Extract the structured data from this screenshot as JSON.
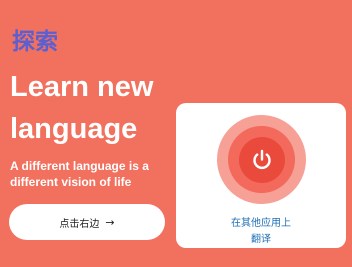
{
  "screen": {
    "title": "探索"
  },
  "hero": {
    "title_line1": "Learn new",
    "title_line2": "language",
    "subtitle": "A different language is a different vision of life"
  },
  "cta": {
    "label": "点击右边",
    "arrow_icon": "arrow-right-icon",
    "arrow_glyph": "→"
  },
  "translate_card": {
    "icon": "power-icon",
    "caption_line1": "在其他应用上",
    "caption_line2": "翻译"
  },
  "colors": {
    "background": "#f2705e",
    "title_accent": "#5a5fd2",
    "caption_link": "#1f6fb5",
    "power_outer": "#f7a096",
    "power_mid": "#f3695b",
    "power_inner": "#ea4a3c"
  }
}
